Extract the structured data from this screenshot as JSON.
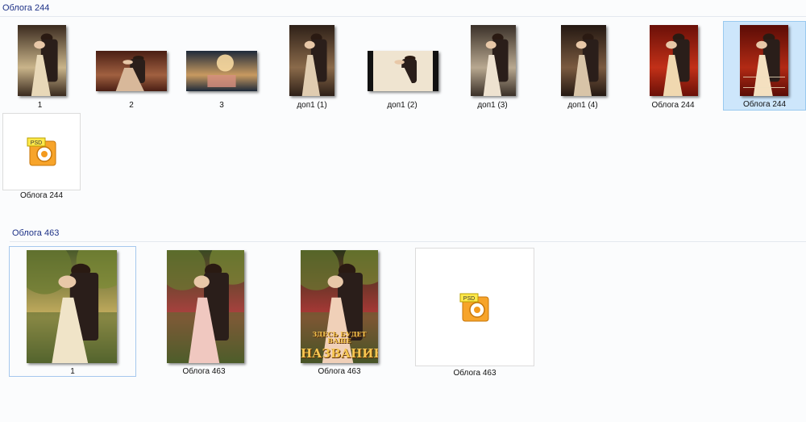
{
  "groups": [
    {
      "header": "Облога 244",
      "items": [
        {
          "label": "1",
          "kind": "portrait-couple",
          "palette": [
            "#3a2a1e",
            "#c9b48a",
            "#e8d8b8"
          ]
        },
        {
          "label": "2",
          "kind": "landscape-couple",
          "palette": [
            "#4a1e14",
            "#a06040",
            "#d8b89a"
          ]
        },
        {
          "label": "3",
          "kind": "landscape-ballroom",
          "palette": [
            "#1e2a3a",
            "#c89a60",
            "#f0c090"
          ]
        },
        {
          "label": "доп1 (1)",
          "kind": "portrait-couple",
          "palette": [
            "#2e2018",
            "#8a6a4a",
            "#e0ccb0"
          ]
        },
        {
          "label": "доп1 (2)",
          "kind": "landscape-dress",
          "palette": [
            "#111111",
            "#cdbfa8",
            "#efe4d0"
          ]
        },
        {
          "label": "доп1 (3)",
          "kind": "portrait-couple",
          "palette": [
            "#3a3028",
            "#b8a890",
            "#eee2d0"
          ]
        },
        {
          "label": "доп1 (4)",
          "kind": "portrait-couple",
          "palette": [
            "#241812",
            "#7a5a40",
            "#d8c4a8"
          ]
        },
        {
          "label": "Облога  244",
          "kind": "portrait-red",
          "palette": [
            "#6a1008",
            "#c23018",
            "#f0d8b0"
          ]
        },
        {
          "label": "Облога 244",
          "kind": "portrait-red-title",
          "palette": [
            "#5a0c06",
            "#b22a14",
            "#f4e0c0"
          ],
          "selected": true
        },
        {
          "label": "Облога 244",
          "kind": "psd"
        }
      ]
    },
    {
      "header": "Облога 463",
      "items": [
        {
          "label": "1",
          "kind": "garden",
          "palette": [
            "#4a5a2a",
            "#c8b060",
            "#f0e4c8"
          ],
          "focused": true
        },
        {
          "label": "Облога  463",
          "kind": "garden-pink",
          "palette": [
            "#3a4a22",
            "#b04040",
            "#f0c8c0"
          ]
        },
        {
          "label": "Облога 463",
          "kind": "garden-title",
          "palette": [
            "#2a3418",
            "#b03838",
            "#f0d0b8"
          ],
          "title_lines": [
            "ЗДЕСЬ БУДЕТ ВАШЕ",
            "НАЗВАНИЕ"
          ]
        },
        {
          "label": "Облога 463",
          "kind": "psd"
        }
      ]
    }
  ],
  "psd_badge": "PSD",
  "colors": {
    "header": "#1e3287",
    "selection_fill": "#cde6fb",
    "selection_border": "#99c9ef",
    "psd_orange": "#f39a1e"
  }
}
